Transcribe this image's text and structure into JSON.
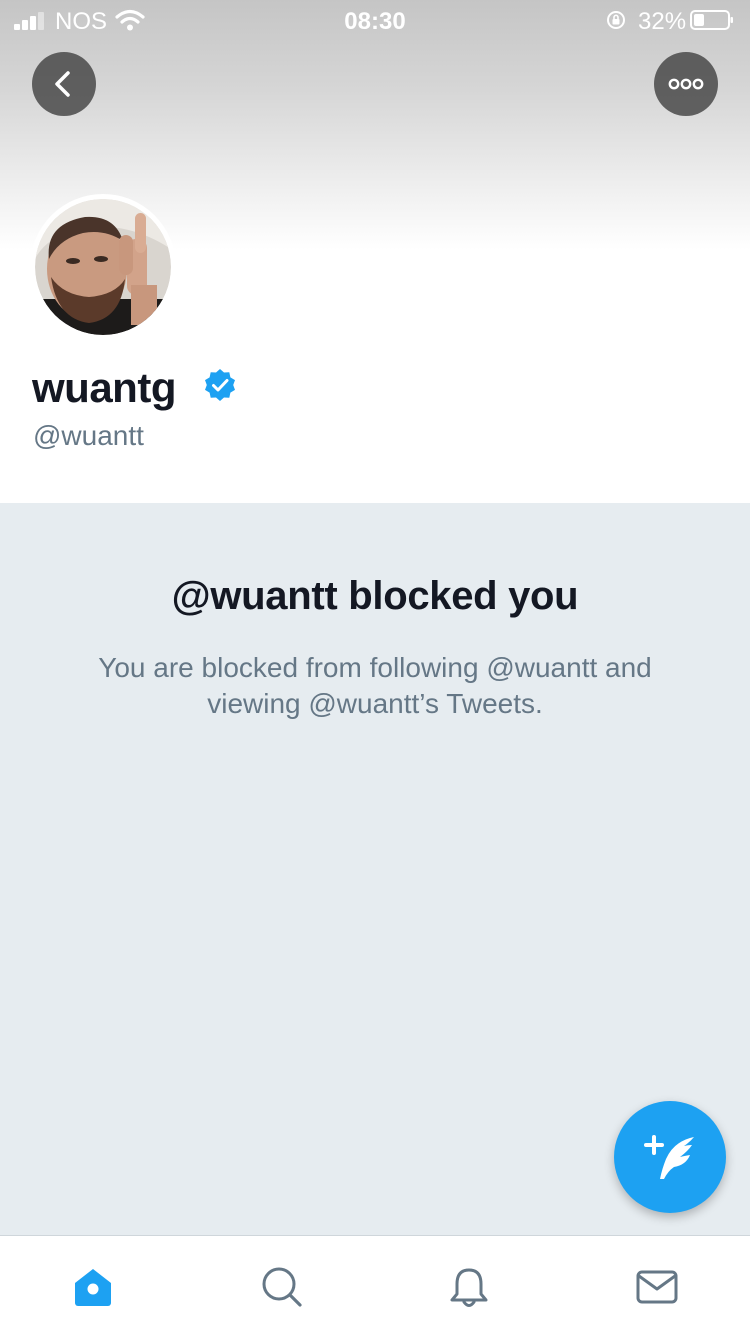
{
  "status_bar": {
    "carrier": "NOS",
    "time": "08:30",
    "battery_percent": "32%"
  },
  "header": {
    "back_icon": "chevron-left-icon",
    "more_icon": "more-dots-icon"
  },
  "profile": {
    "name": "wuantg",
    "handle": "@wuantt",
    "verified_icon": "verified-badge-icon"
  },
  "blocked": {
    "title": "@wuantt blocked you",
    "description": "You are blocked from following @wuantt and viewing @wuantt’s Tweets."
  },
  "tabs": [
    {
      "icon": "home-icon",
      "active": true
    },
    {
      "icon": "search-icon",
      "active": false
    },
    {
      "icon": "notifications-bell-icon",
      "active": false
    },
    {
      "icon": "messages-envelope-icon",
      "active": false
    }
  ],
  "colors": {
    "accent": "#1da1f2",
    "panel_background": "#e6ecf0",
    "secondary_text": "#657786",
    "inactive_icon": "#657786"
  }
}
